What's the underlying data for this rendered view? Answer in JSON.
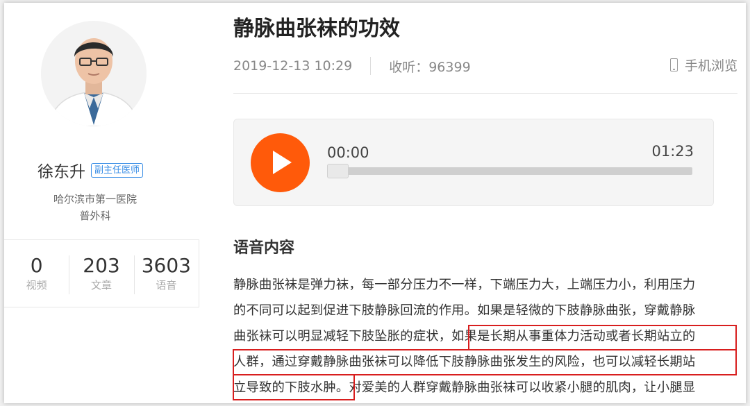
{
  "doctor": {
    "name": "徐东升",
    "title": "副主任医师",
    "hospital": "哈尔滨市第一医院",
    "department": "普外科"
  },
  "stats": [
    {
      "value": "0",
      "label": "视频"
    },
    {
      "value": "203",
      "label": "文章"
    },
    {
      "value": "3603",
      "label": "语音"
    }
  ],
  "article": {
    "title": "静脉曲张袜的功效",
    "date": "2019-12-13 10:29",
    "listen": "收听：96399",
    "mobile_label": "手机浏览"
  },
  "player": {
    "current_time": "00:00",
    "total_time": "01:23",
    "progress": 0
  },
  "content": {
    "section_title": "语音内容",
    "lines": [
      "静脉曲张袜是弹力袜，每一部分压力不一样，下端压力大，上端压力小，利用压力",
      "的不同可以起到促进下肢静脉回流的作用。如果是轻微的下肢静脉曲张，穿戴静脉",
      "曲张袜可以明显减轻下肢坠胀的症状，如果是长期从事重体力活动或者长期站立的",
      "人群，通过穿戴静脉曲张袜可以降低下肢静脉曲张发生的风险，也可以减轻长期站",
      "立导致的下肢水肿。对爱美的人群穿戴静脉曲张袜可以收紧小腿的肌肉，让小腿显"
    ]
  },
  "colors": {
    "accent": "#ff5a0a",
    "title_badge": "#3a8ee6",
    "highlight_border": "#d81e1e"
  }
}
